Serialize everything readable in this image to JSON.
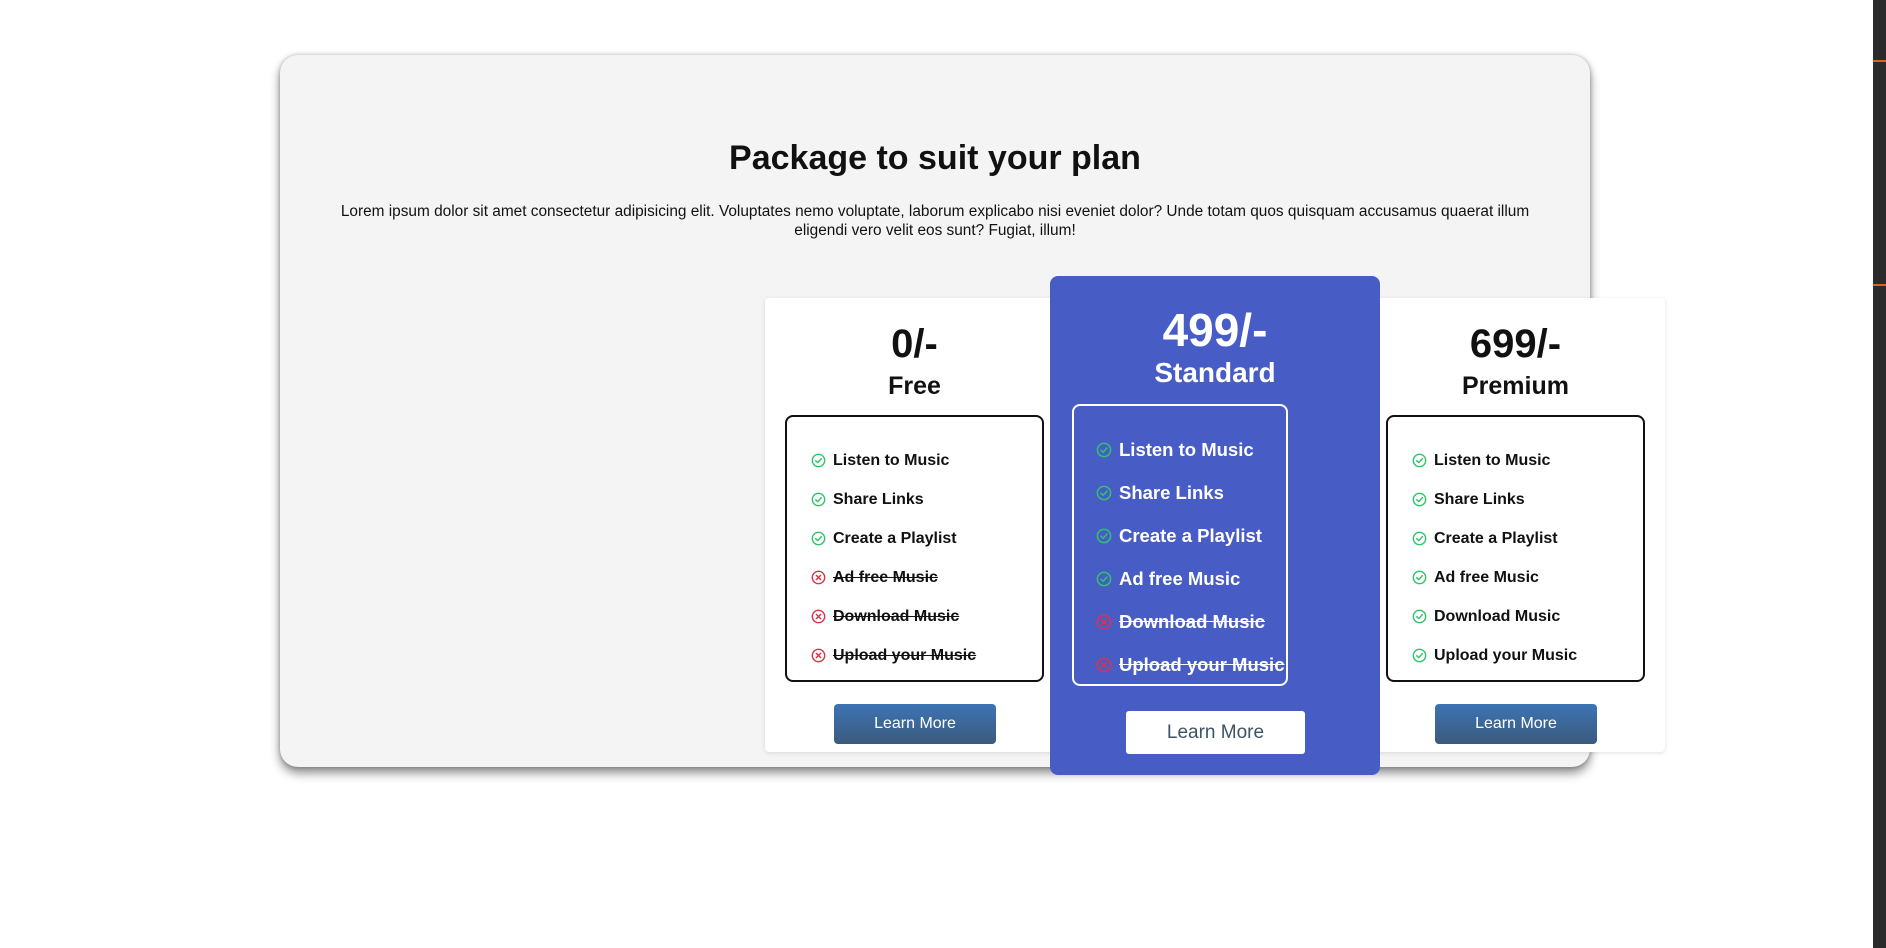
{
  "page": {
    "title": "Package to suit your plan",
    "description": "Lorem ipsum dolor sit amet consectetur adipisicing elit. Voluptates nemo voluptate, laborum explicabo nisi eveniet dolor? Unde totam quos quisquam accusamus quaerat illum eligendi vero velit eos sunt? Fugiat, illum!"
  },
  "colors": {
    "accent": "#475dc5",
    "included": "#2ec46a",
    "excluded": "#e0304a",
    "button_gradient_top": "#3d74b5",
    "button_gradient_bottom": "#3b5a7c"
  },
  "icons": {
    "included": "check-circle-icon",
    "excluded": "x-circle-icon"
  },
  "plans": [
    {
      "price": "0/-",
      "name": "Free",
      "button_label": "Learn More",
      "features": [
        {
          "label": "Listen to Music",
          "included": true
        },
        {
          "label": "Share Links",
          "included": true
        },
        {
          "label": "Create a Playlist",
          "included": true
        },
        {
          "label": "Ad free Music",
          "included": false
        },
        {
          "label": "Download Music",
          "included": false
        },
        {
          "label": "Upload your Music",
          "included": false
        }
      ]
    },
    {
      "price": "499/-",
      "name": "Standard",
      "button_label": "Learn More",
      "features": [
        {
          "label": "Listen to Music",
          "included": true
        },
        {
          "label": "Share Links",
          "included": true
        },
        {
          "label": "Create a Playlist",
          "included": true
        },
        {
          "label": "Ad free Music",
          "included": true
        },
        {
          "label": "Download Music",
          "included": false
        },
        {
          "label": "Upload your Music",
          "included": false
        }
      ]
    },
    {
      "price": "699/-",
      "name": "Premium",
      "button_label": "Learn More",
      "features": [
        {
          "label": "Listen to Music",
          "included": true
        },
        {
          "label": "Share Links",
          "included": true
        },
        {
          "label": "Create a Playlist",
          "included": true
        },
        {
          "label": "Ad free Music",
          "included": true
        },
        {
          "label": "Download Music",
          "included": true
        },
        {
          "label": "Upload your Music",
          "included": true
        }
      ]
    }
  ]
}
